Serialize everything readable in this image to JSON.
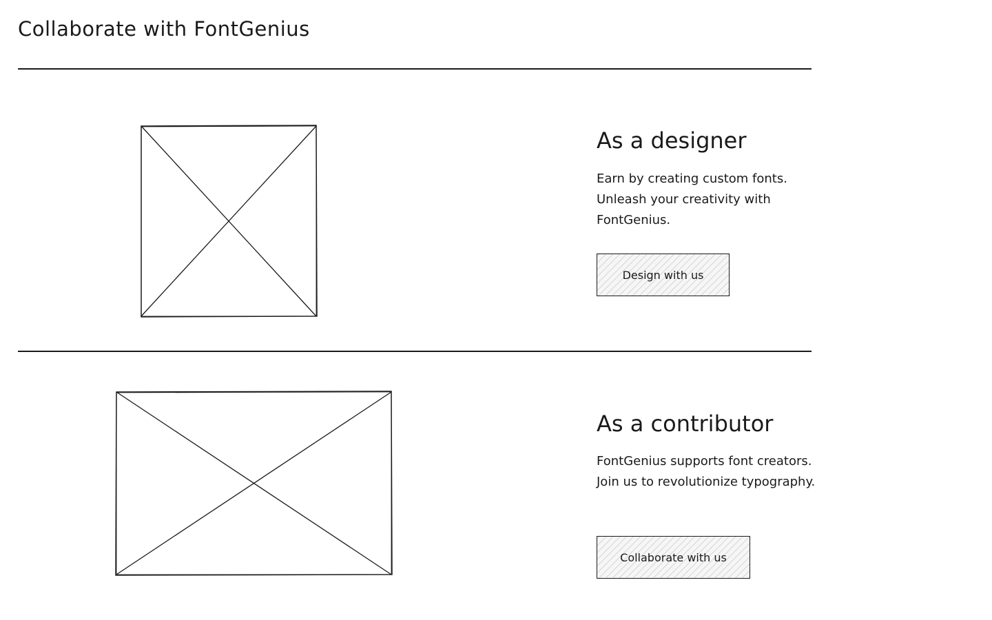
{
  "header": {
    "title": "Collaborate with FontGenius"
  },
  "sections": [
    {
      "heading": "As a designer",
      "body": "Earn by creating custom fonts. Unleash your creativity with FontGenius.",
      "button_label": "Design with us"
    },
    {
      "heading": "As a contributor",
      "body": "FontGenius supports font creators. Join us to revolutionize typography.",
      "button_label": "Collaborate with us"
    }
  ],
  "colors": {
    "ink": "#1a1a1a",
    "background": "#ffffff",
    "button_fill": "#f6f6f6"
  },
  "icons": {
    "image_placeholder": "image-placeholder-icon"
  }
}
